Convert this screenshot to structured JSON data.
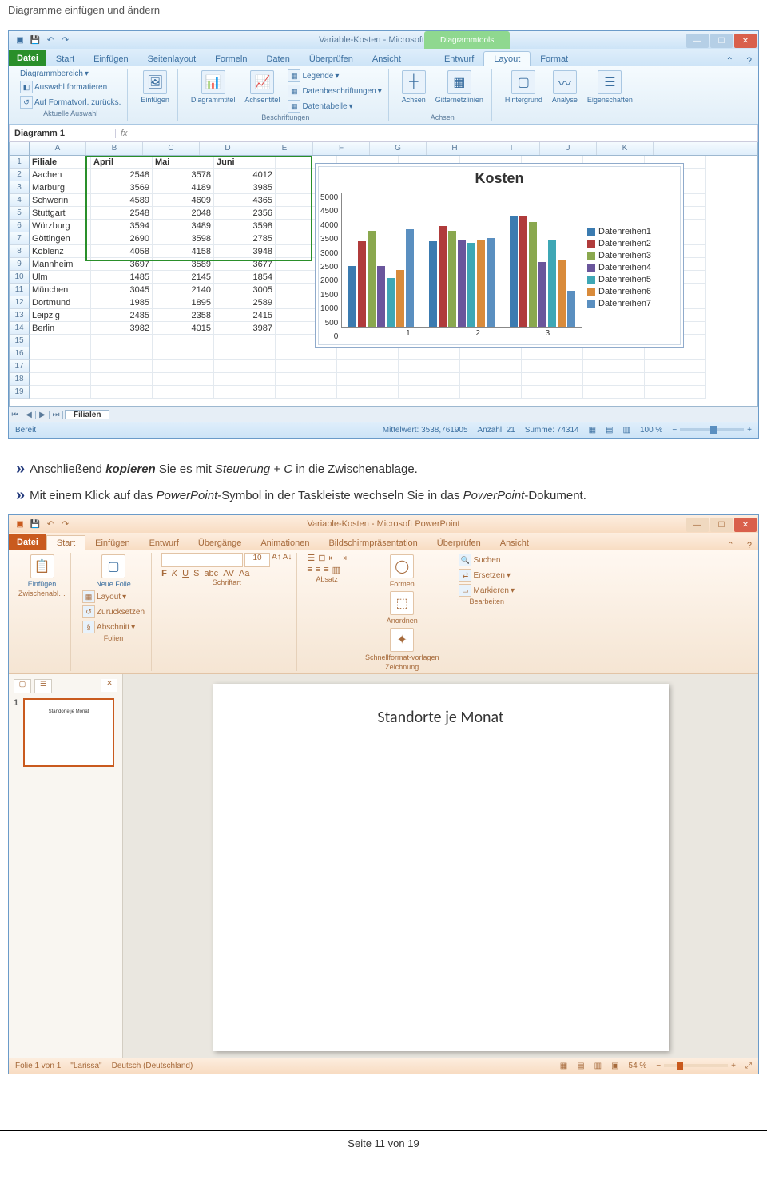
{
  "doc": {
    "header": "Diagramme einfügen und ändern",
    "footer_prefix": "Seite ",
    "footer_page": "11",
    "footer_mid": " von ",
    "footer_total": "19"
  },
  "body": {
    "bullet1_a": "Anschließend ",
    "bullet1_b": "kopieren",
    "bullet1_c": " Sie es mit ",
    "bullet1_d": "Steuerung + C",
    "bullet1_e": " in die Zwischenablage.",
    "bullet2_a": "Mit einem Klick auf das ",
    "bullet2_b": "PowerPoint",
    "bullet2_c": "-Symbol in der Taskleiste wechseln Sie in das ",
    "bullet2_d": "PowerPoint",
    "bullet2_e": "-Dokument."
  },
  "excel": {
    "title": "Variable-Kosten - Microsoft Excel",
    "contextual": "Diagrammtools",
    "tabs": {
      "file": "Datei",
      "start": "Start",
      "einf": "Einfügen",
      "layout": "Seitenlayout",
      "form": "Formeln",
      "daten": "Daten",
      "pruef": "Überprüfen",
      "ans": "Ansicht",
      "entw": "Entwurf",
      "lay": "Layout",
      "fmt": "Format"
    },
    "ribbon": {
      "g1": {
        "b1": "Diagrammbereich",
        "b2": "Auswahl formatieren",
        "b3": "Auf Formatvorl. zurücks.",
        "label": "Aktuelle Auswahl"
      },
      "g2": {
        "b1": "Einfügen"
      },
      "g3": {
        "b1": "Diagrammtitel",
        "b2": "Achsentitel",
        "b3": "Legende",
        "b4": "Datenbeschriftungen",
        "b5": "Datentabelle",
        "label": "Beschriftungen"
      },
      "g4": {
        "b1": "Achsen",
        "b2": "Gitternetzlinien",
        "label": "Achsen"
      },
      "g5": {
        "b1": "Hintergrund",
        "b2": "Analyse",
        "b3": "Eigenschaften"
      }
    },
    "namebox": "Diagramm 1",
    "fx": "fx",
    "cols": [
      "A",
      "B",
      "C",
      "D",
      "E",
      "F",
      "G",
      "H",
      "I",
      "J",
      "K"
    ],
    "headers": [
      "Filiale",
      "April",
      "Mai",
      "Juni"
    ],
    "data": [
      [
        "Aachen",
        "2548",
        "3578",
        "4012"
      ],
      [
        "Marburg",
        "3569",
        "4189",
        "3985"
      ],
      [
        "Schwerin",
        "4589",
        "4609",
        "4365"
      ],
      [
        "Stuttgart",
        "2548",
        "2048",
        "2356"
      ],
      [
        "Würzburg",
        "3594",
        "3489",
        "3598"
      ],
      [
        "Göttingen",
        "2690",
        "3598",
        "2785"
      ],
      [
        "Koblenz",
        "4058",
        "4158",
        "3948"
      ],
      [
        "Mannheim",
        "3697",
        "3589",
        "3677"
      ],
      [
        "Ulm",
        "1485",
        "2145",
        "1854"
      ],
      [
        "München",
        "3045",
        "2140",
        "3005"
      ],
      [
        "Dortmund",
        "1985",
        "1895",
        "2589"
      ],
      [
        "Leipzig",
        "2485",
        "2358",
        "2415"
      ],
      [
        "Berlin",
        "3982",
        "4015",
        "3987"
      ]
    ],
    "sheet_tab": "Filialen",
    "status": {
      "ready": "Bereit",
      "avg": "Mittelwert: 3538,761905",
      "cnt": "Anzahl: 21",
      "sum": "Summe: 74314",
      "zoom": "100 %"
    }
  },
  "chart_data": {
    "type": "bar",
    "title": "Kosten",
    "ylim": [
      0,
      5000
    ],
    "yticks": [
      "5000",
      "4500",
      "4000",
      "3500",
      "3000",
      "2500",
      "2000",
      "1500",
      "1000",
      "500",
      "0"
    ],
    "categories": [
      "1",
      "2",
      "3"
    ],
    "series": [
      {
        "name": "Datenreihen1",
        "color": "#3b7bb0",
        "values": [
          2548,
          3569,
          4589
        ]
      },
      {
        "name": "Datenreihen2",
        "color": "#b03b3b",
        "values": [
          3578,
          4189,
          4609
        ]
      },
      {
        "name": "Datenreihen3",
        "color": "#8aa84e",
        "values": [
          4012,
          3985,
          4365
        ]
      },
      {
        "name": "Datenreihen4",
        "color": "#6a569c",
        "values": [
          2548,
          3594,
          2690
        ]
      },
      {
        "name": "Datenreihen5",
        "color": "#3ea7b5",
        "values": [
          2048,
          3489,
          3598
        ]
      },
      {
        "name": "Datenreihen6",
        "color": "#d98b3b",
        "values": [
          2356,
          3598,
          2785
        ]
      },
      {
        "name": "Datenreihen7",
        "color": "#5a8fc0",
        "values": [
          4058,
          3697,
          1485
        ]
      }
    ]
  },
  "pp": {
    "title": "Variable-Kosten - Microsoft PowerPoint",
    "tabs": {
      "file": "Datei",
      "start": "Start",
      "einf": "Einfügen",
      "entw": "Entwurf",
      "ueb": "Übergänge",
      "anim": "Animationen",
      "pres": "Bildschirmpräsentation",
      "pruef": "Überprüfen",
      "ans": "Ansicht"
    },
    "ribbon": {
      "g1": {
        "b1": "Einfügen",
        "label": "Zwischenabl…"
      },
      "g2": {
        "b1": "Neue Folie",
        "b2": "Layout",
        "b3": "Zurücksetzen",
        "b4": "Abschnitt",
        "label": "Folien"
      },
      "g3": {
        "label": "Schriftart",
        "size": "10"
      },
      "g4": {
        "label": "Absatz"
      },
      "g5": {
        "b1": "Formen",
        "b2": "Anordnen",
        "b3": "Schnellformat-vorlagen",
        "label": "Zeichnung"
      },
      "g6": {
        "b1": "Suchen",
        "b2": "Ersetzen",
        "b3": "Markieren",
        "label": "Bearbeiten"
      }
    },
    "slide_title": "Standorte je Monat",
    "thumb_text": "Standorte je Monat",
    "status": {
      "slide": "Folie 1 von 1",
      "theme": "\"Larissa\"",
      "lang": "Deutsch (Deutschland)",
      "zoom": "54 %"
    }
  }
}
